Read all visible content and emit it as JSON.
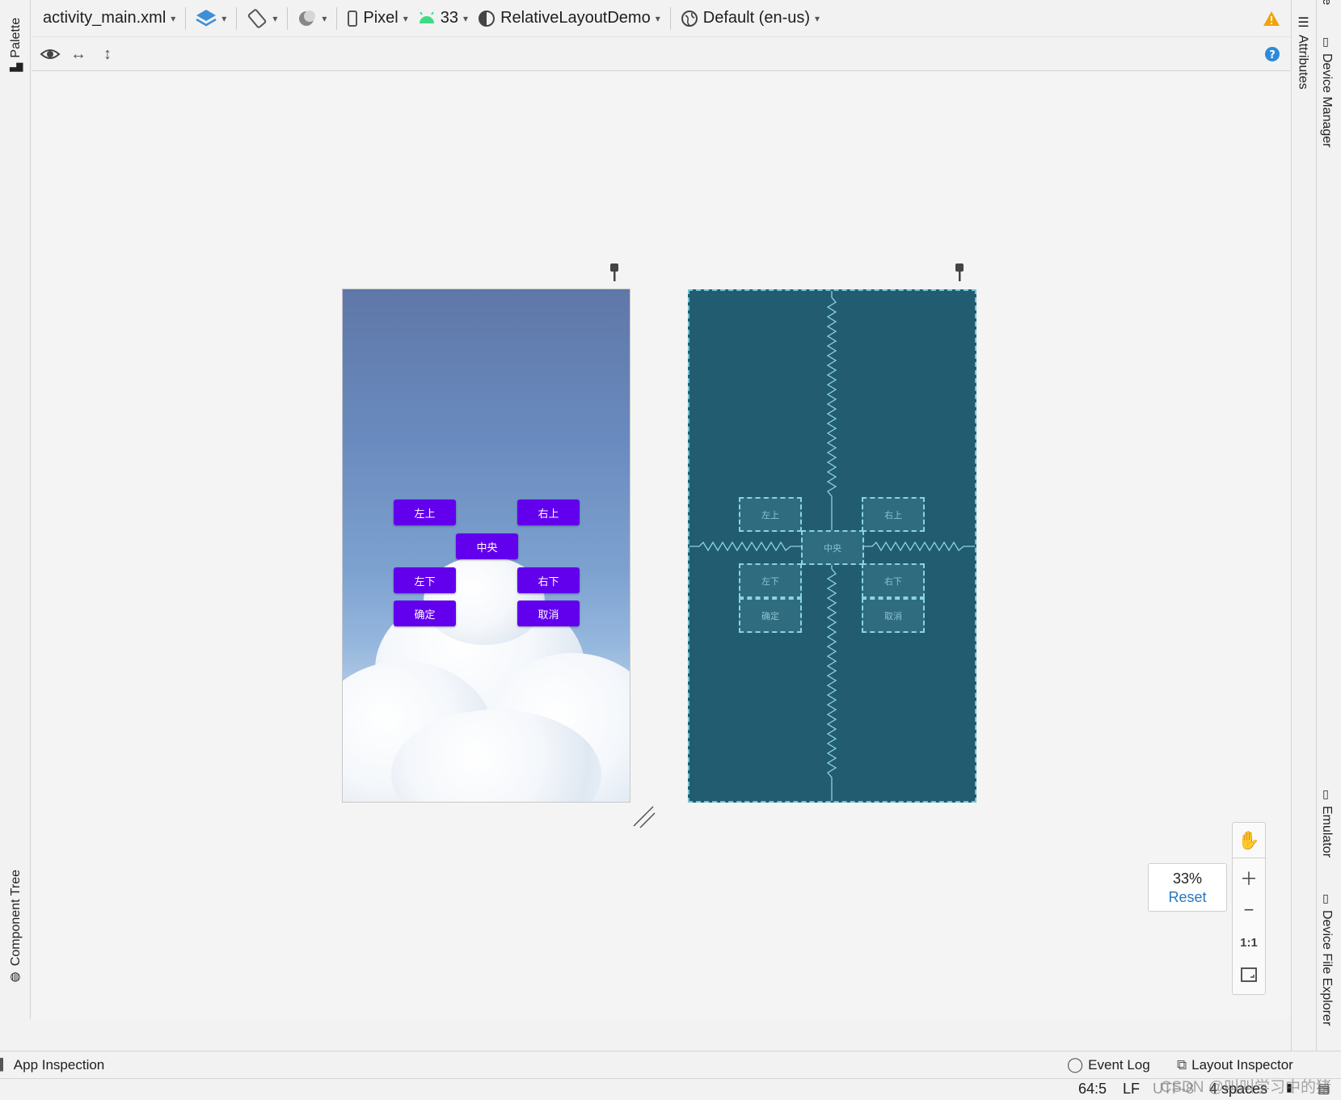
{
  "toolbar": {
    "file_name": "activity_main.xml",
    "device": "Pixel",
    "api_level": "33",
    "theme": "RelativeLayoutDemo",
    "locale": "Default (en-us)"
  },
  "side_tabs": {
    "palette": "Palette",
    "component_tree": "Component Tree",
    "attributes": "Attributes",
    "device_manager": "Device Manager",
    "emulator": "Emulator",
    "device_file_explorer": "Device File Explorer",
    "edge_char": "e"
  },
  "buttons": {
    "top_left": "左上",
    "top_right": "右上",
    "center": "中央",
    "bottom_left": "左下",
    "bottom_right": "右下",
    "confirm": "确定",
    "cancel": "取消"
  },
  "zoom": {
    "percent": "33%",
    "reset": "Reset",
    "one_to_one": "1:1"
  },
  "bottom_bar": {
    "app_inspection": "App Inspection",
    "event_log": "Event Log",
    "layout_inspector": "Layout Inspector"
  },
  "status_bar": {
    "position": "64:5",
    "line_ending": "LF",
    "encoding": "UTF-8",
    "indent": "4 spaces"
  },
  "watermark": "CSDN @叫叫学习中的猪",
  "colors": {
    "button_purple": "#6200ee",
    "blueprint_bg": "#225c70",
    "blueprint_line": "#6fc4d8",
    "accent_blue": "#2675bf",
    "warning": "#f0a30a"
  },
  "icons": [
    "palette-icon",
    "layers-icon",
    "orientation-icon",
    "night-mode-icon",
    "phone-icon",
    "android-icon",
    "theme-icon",
    "globe-icon",
    "warning-icon",
    "eye-icon",
    "pan-horizontal-icon",
    "pan-vertical-icon",
    "help-icon",
    "pin-icon",
    "hand-icon",
    "zoom-in-icon",
    "zoom-out-icon",
    "fit-screen-icon",
    "resize-handle-icon",
    "event-log-icon",
    "layout-inspector-icon"
  ]
}
